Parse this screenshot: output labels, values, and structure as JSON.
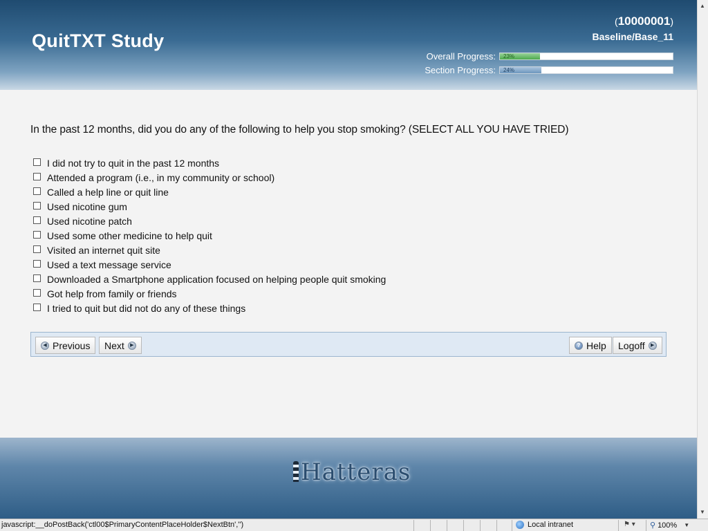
{
  "header": {
    "title": "QuitTXT Study",
    "participant_open": "(",
    "participant_id": "10000001",
    "participant_close": ")",
    "section": "Baseline/Base_11",
    "overall_progress": {
      "label": "Overall Progress:",
      "percent_text": "23%",
      "value": 0.23,
      "color": "#4caa4c"
    },
    "section_progress": {
      "label": "Section Progress:",
      "percent_text": "24%",
      "value": 0.24,
      "color": "#6d97bd"
    }
  },
  "question": {
    "text": "In the past 12 months, did you do any of the following to help you stop smoking? (SELECT ALL YOU HAVE TRIED)",
    "options": [
      "I did not try to quit in the past 12 months",
      "Attended a program (i.e., in my community or school)",
      "Called a help line or quit line",
      "Used nicotine gum",
      "Used nicotine patch",
      "Used some other medicine to help quit",
      "Visited an internet quit site",
      "Used a text message service",
      "Downloaded a Smartphone application focused on helping people quit smoking",
      "Got help from family or friends",
      "I tried to quit but did not do any of these things"
    ]
  },
  "nav": {
    "previous": "Previous",
    "next": "Next",
    "help": "Help",
    "logoff": "Logoff"
  },
  "footer": {
    "brand": "Hatteras"
  },
  "statusbar": {
    "link_text": "javascript:__doPostBack('ctl00$PrimaryContentPlaceHolder$NextBtn','')",
    "zone": "Local intranet",
    "zoom": "100%"
  }
}
